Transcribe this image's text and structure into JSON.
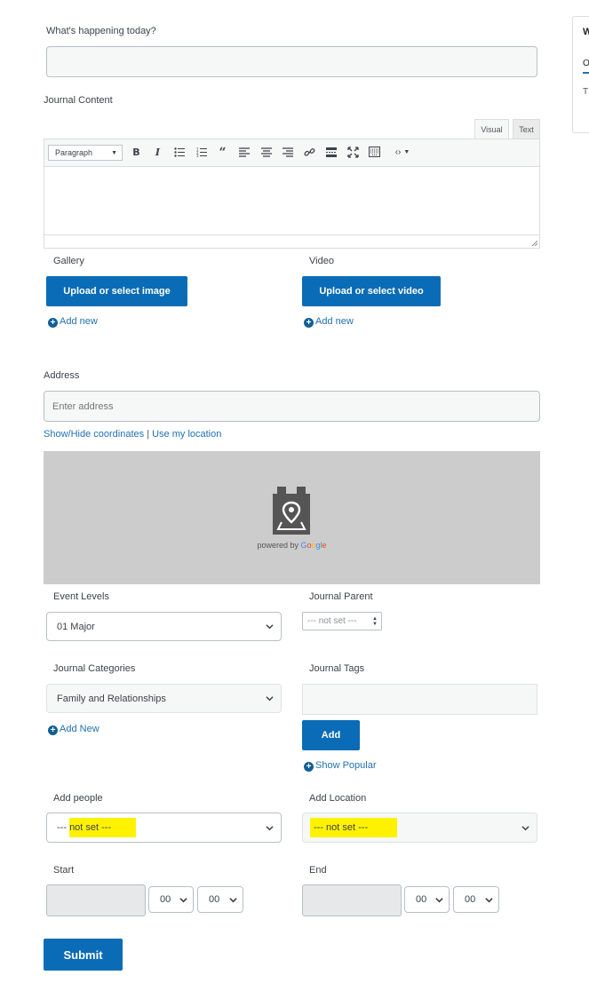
{
  "form": {
    "happening_label": "What's happening today?",
    "happening_value": "",
    "content_label": "Journal Content",
    "editor_tabs": [
      "Visual",
      "Text"
    ],
    "format_select": "Paragraph",
    "gallery_label": "Gallery",
    "gallery_button": "Upload or select image",
    "gallery_add": "Add new",
    "video_label": "Video",
    "video_button": "Upload or select video",
    "video_add": "Add new",
    "address_label": "Address",
    "address_placeholder": "Enter address",
    "show_hide_coords": "Show/Hide coordinates",
    "separator": "|",
    "use_location": "Use my location",
    "map_powered_prefix": "powered by",
    "map_google": [
      "G",
      "o",
      "o",
      "g",
      "l",
      "e"
    ],
    "event_levels_label": "Event Levels",
    "event_levels_value": "01 Major",
    "journal_parent_label": "Journal Parent",
    "journal_parent_value": "--- not set ---",
    "categories_label": "Journal Categories",
    "categories_value": "Family and Relationships",
    "categories_add": "Add New",
    "tags_label": "Journal Tags",
    "tags_add_button": "Add",
    "show_popular": "Show Popular",
    "add_people_label": "Add people",
    "add_people_value_prefix": "---",
    "add_people_value_hl": "not set ---",
    "add_location_label": "Add Location",
    "add_location_value": "--- not set ---",
    "start_label": "Start",
    "start_hour": "00",
    "start_min": "00",
    "end_label": "End",
    "end_hour": "00",
    "end_min": "00",
    "submit": "Submit"
  },
  "side_panel": {
    "title_letter": "W",
    "line1": "O",
    "line2": "T"
  },
  "colors": {
    "primary": "#0a6cb6",
    "link": "#2271b1",
    "highlight": "#fff200",
    "map_bg": "#cccccc"
  }
}
